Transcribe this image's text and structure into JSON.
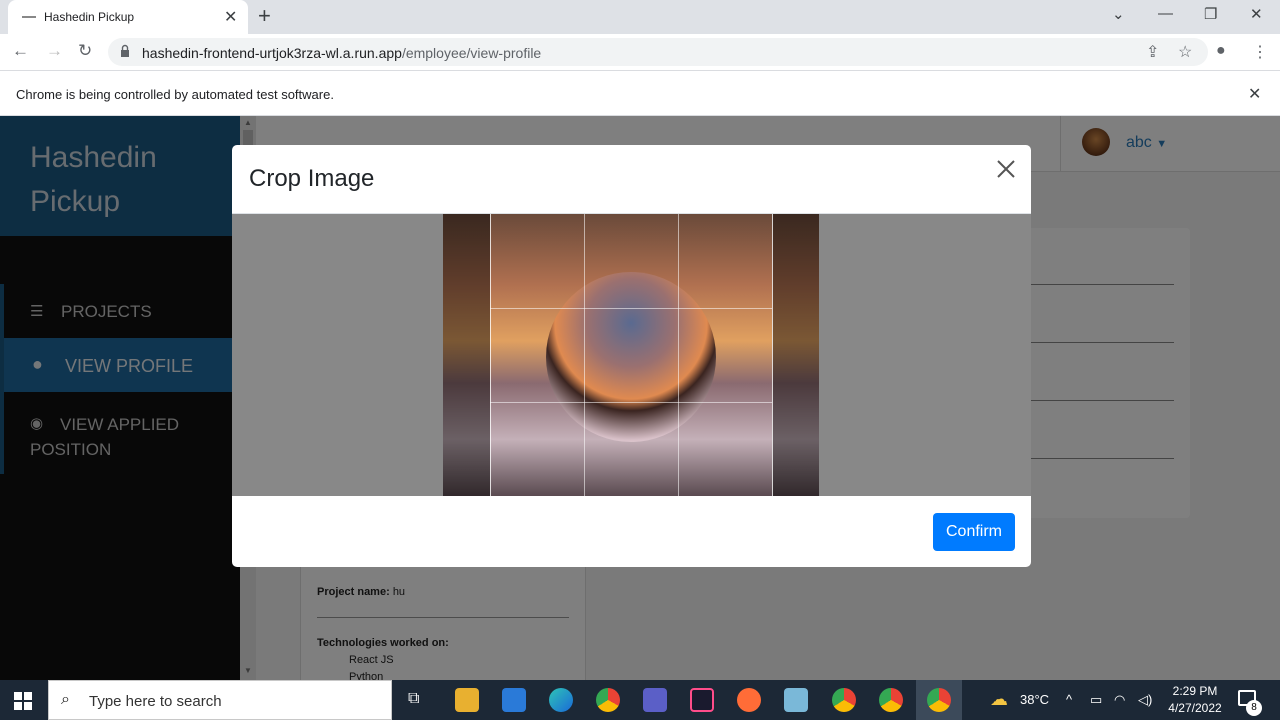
{
  "browser": {
    "tab_title": "Hashedin Pickup",
    "url_host": "hashedin-frontend-urtjok3rza-wl.a.run.app",
    "url_path": "/employee/view-profile",
    "infobar_message": "Chrome is being controlled by automated test software."
  },
  "sidebar": {
    "brand": "Hashedin Pickup",
    "items": [
      {
        "label": "PROJECTS",
        "icon": "list-icon"
      },
      {
        "label": "VIEW PROFILE",
        "icon": "user-circle-icon"
      },
      {
        "label": "VIEW APPLIED POSITION",
        "icon": "eye-icon"
      }
    ]
  },
  "topnav": {
    "username": "abc"
  },
  "profile": {
    "project_label": "Project name:",
    "project_name": "hu",
    "tech_label": "Technologies worked on:",
    "technologies": [
      "React JS",
      "Python"
    ]
  },
  "modal": {
    "title": "Crop Image",
    "confirm_label": "Confirm"
  },
  "taskbar": {
    "search_placeholder": "Type here to search",
    "temperature": "38°C",
    "time": "2:29 PM",
    "date": "4/27/2022",
    "notification_count": "8"
  },
  "colors": {
    "sidebar_brand": "#1b5a85",
    "sidebar_active": "#1f6aa0",
    "confirm_button": "#007bff",
    "link": "#2a7ab8"
  }
}
